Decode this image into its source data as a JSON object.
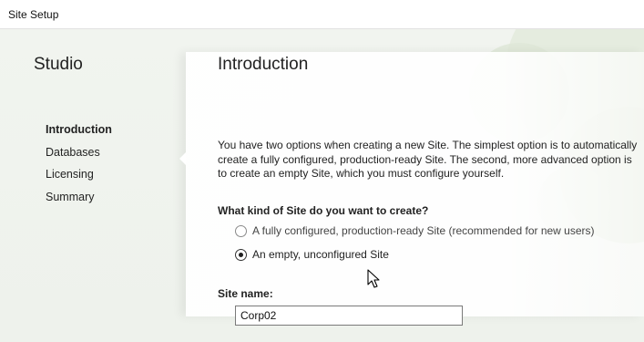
{
  "window": {
    "title": "Site Setup"
  },
  "sidebar": {
    "title": "Studio",
    "items": [
      {
        "label": "Introduction",
        "active": true
      },
      {
        "label": "Databases",
        "active": false
      },
      {
        "label": "Licensing",
        "active": false
      },
      {
        "label": "Summary",
        "active": false
      }
    ]
  },
  "main": {
    "title": "Introduction",
    "intro_text": "You have two options when creating a new Site. The simplest option is to automatically create a fully configured, production-ready Site. The second, more advanced option is to create an empty Site, which you must configure yourself.",
    "question": "What kind of Site do you want to create?",
    "options": [
      {
        "label": "A fully configured, production-ready Site (recommended for new users)",
        "selected": false
      },
      {
        "label": "An empty, unconfigured Site",
        "selected": true
      }
    ],
    "site_name": {
      "label": "Site name:",
      "value": "Corp02"
    }
  },
  "colors": {
    "background": "#eef2ec",
    "decoration": "#dfe6d6",
    "content_panel": "#ffffff"
  }
}
